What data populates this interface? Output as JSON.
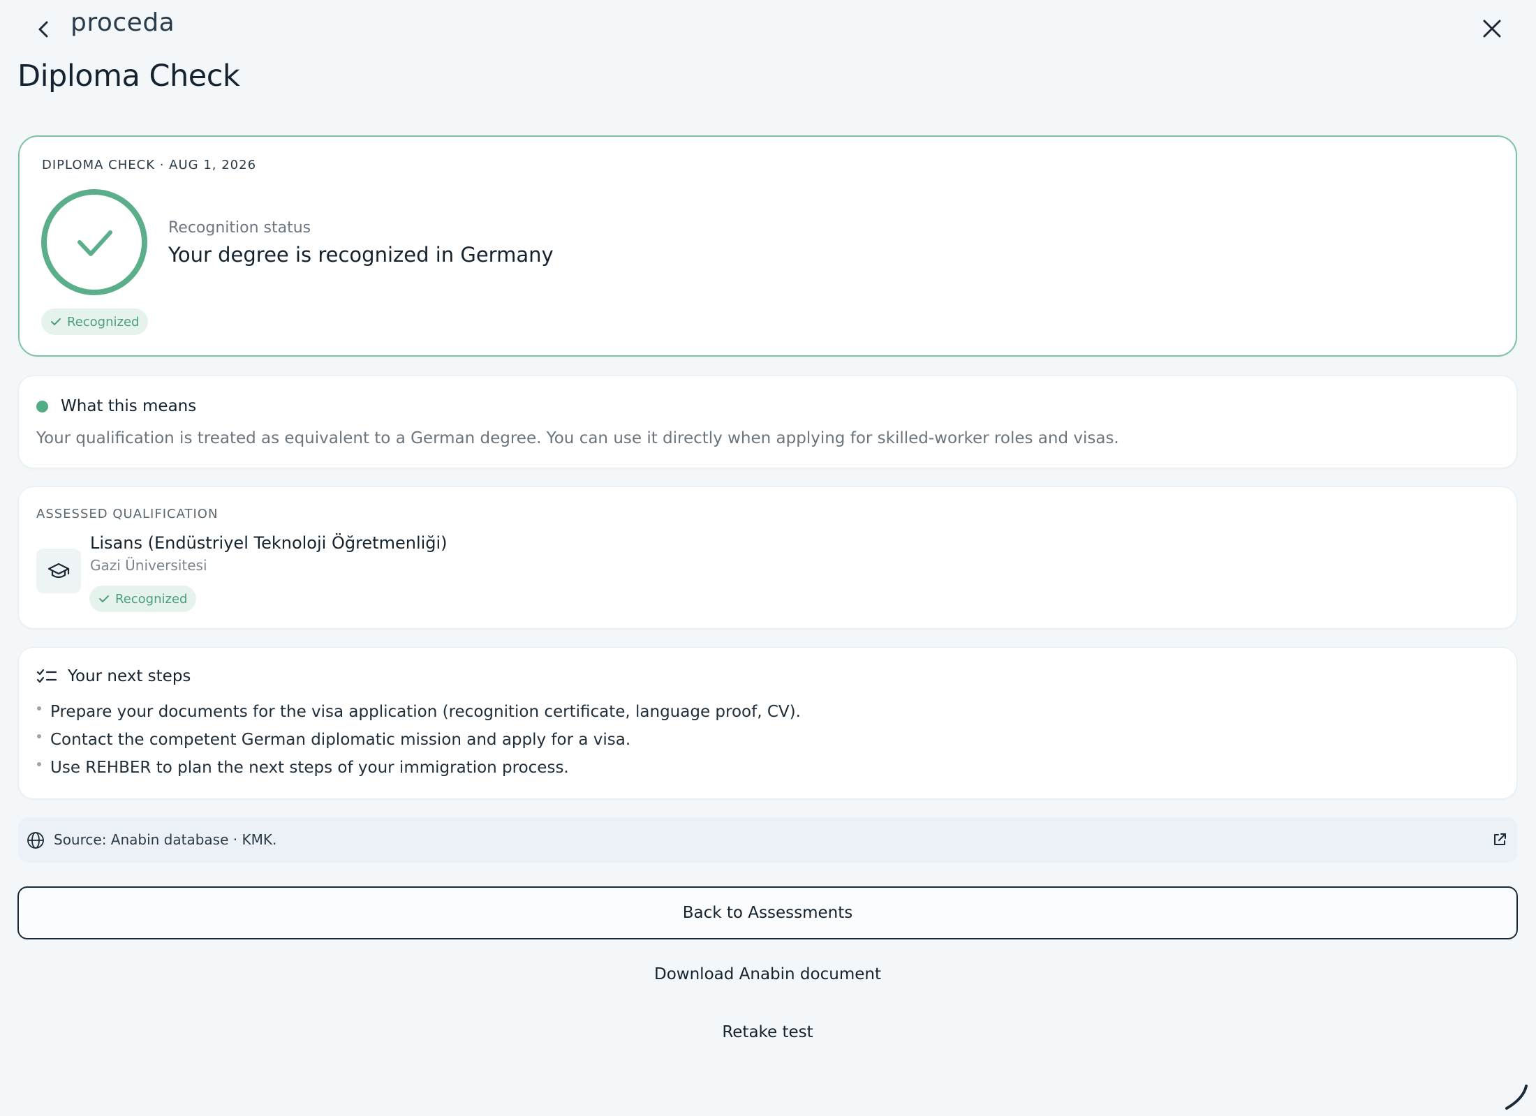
{
  "app": {
    "logo": "proceda",
    "page_title": "Diploma Check"
  },
  "status_card": {
    "eyebrow": "DIPLOMA CHECK · AUG 1, 2026",
    "label": "Recognition status",
    "headline": "Your degree is recognized in Germany",
    "badge": "Recognized",
    "ring_color": "#5aae8a"
  },
  "means_card": {
    "title": "What this means",
    "text": "Your qualification is treated as equivalent to a German degree. You can use it directly when applying for skilled-worker roles and visas."
  },
  "qualification_card": {
    "eyebrow": "ASSESSED QUALIFICATION",
    "name": "Lisans (Endüstriyel Teknoloji Öğretmenliği)",
    "university": "Gazi Üniversitesi",
    "badge": "Recognized",
    "icon": "graduation-cap-icon"
  },
  "steps_card": {
    "title": "Your next steps",
    "items": [
      "Prepare your documents for the visa application (recognition certificate, language proof, CV).",
      "Contact the competent German diplomatic mission and apply for a visa.",
      "Use REHBER to plan the next steps of your immigration process."
    ]
  },
  "source": {
    "text": "Source: Anabin database · KMK."
  },
  "actions": {
    "back_label": "Back to Assessments",
    "download_label": "Download Anabin document",
    "retake_label": "Retake test"
  },
  "colors": {
    "accent_green": "#5aae8a",
    "background": "#f3f7fa",
    "text_dark": "#14222e"
  }
}
